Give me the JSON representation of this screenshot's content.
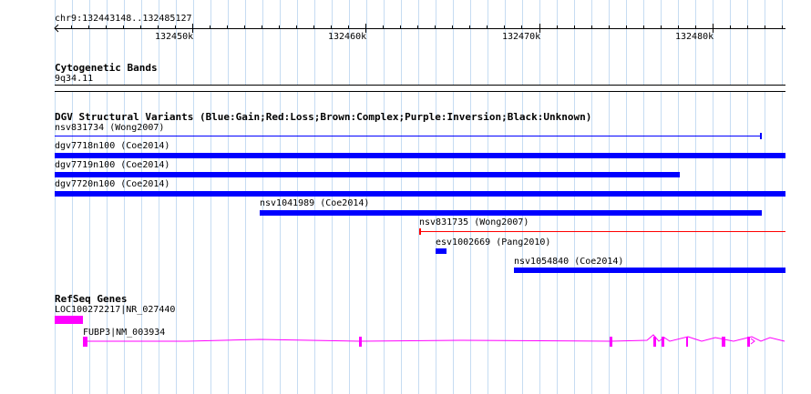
{
  "ruler": {
    "region": "chr9:132443148..132485127",
    "ticks": [
      "132450k",
      "132460k",
      "132470k",
      "132480k"
    ]
  },
  "cytobands": {
    "title": "Cytogenetic Bands",
    "band": "9q34.11"
  },
  "dgv": {
    "title": "DGV Structural Variants (Blue:Gain;Red:Loss;Brown:Complex;Purple:Inversion;Black:Unknown)",
    "features": [
      {
        "label": "nsv831734 (Wong2007)",
        "color": "#0000ff",
        "style": "thin"
      },
      {
        "label": "dgv7718n100 (Coe2014)",
        "color": "#0000ff",
        "style": "thick"
      },
      {
        "label": "dgv7719n100 (Coe2014)",
        "color": "#0000ff",
        "style": "thick"
      },
      {
        "label": "dgv7720n100 (Coe2014)",
        "color": "#0000ff",
        "style": "thick"
      },
      {
        "label": "nsv1041989 (Coe2014)",
        "color": "#0000ff",
        "style": "thick"
      },
      {
        "label": "nsv831735 (Wong2007)",
        "color": "#ff0000",
        "style": "thin"
      },
      {
        "label": "esv1002669 (Pang2010)",
        "color": "#0000ff",
        "style": "thick"
      },
      {
        "label": "nsv1054840 (Coe2014)",
        "color": "#0000ff",
        "style": "thick"
      }
    ]
  },
  "refseq": {
    "title": "RefSeq Genes",
    "color": "#ff00ff",
    "genes": [
      {
        "label": "LOC100272217|NR_027440"
      },
      {
        "label": "FUBP3|NM_003934"
      }
    ]
  }
}
